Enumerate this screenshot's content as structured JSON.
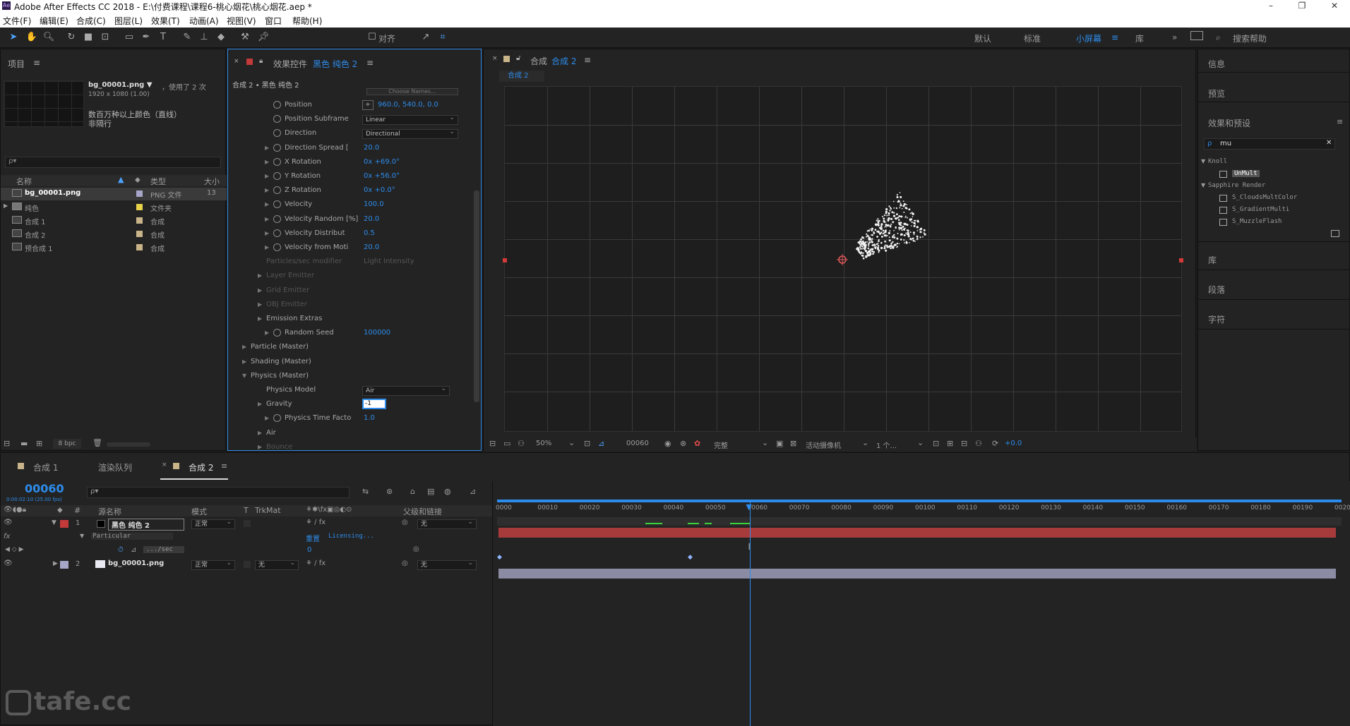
{
  "window": {
    "title": "Adobe After Effects CC 2018 - E:\\付费课程\\课程6-桃心烟花\\桃心烟花.aep *"
  },
  "menu": [
    "文件(F)",
    "编辑(E)",
    "合成(C)",
    "图层(L)",
    "效果(T)",
    "动画(A)",
    "视图(V)",
    "窗口",
    "帮助(H)"
  ],
  "toolbar": {
    "align_label": "对齐",
    "workspaces": [
      "默认",
      "标准",
      "小屏幕",
      "库"
    ],
    "active_workspace": "小屏幕",
    "search_help": "搜索帮助"
  },
  "project": {
    "title": "项目",
    "asset_name": "bg_00001.png ▼",
    "used": "，使用了 2 次",
    "dims": "1920 x 1080 (1.00)",
    "desc1": "数百万种以上颜色（直线）",
    "desc2": "非隔行",
    "search_placeholder": "ρ▾",
    "col_name": "名称",
    "col_type": "类型",
    "col_size": "大小",
    "bpc": "8 bpc",
    "items": [
      {
        "name": "bg_00001.png",
        "type": "PNG 文件",
        "size": "13",
        "color": "#a6a6c8",
        "bold": true
      },
      {
        "name": "纯色",
        "type": "文件夹",
        "size": "",
        "color": "#e8d24a",
        "bold": false
      },
      {
        "name": "合成 1",
        "type": "合成",
        "size": "",
        "color": "#c9b48a",
        "bold": false
      },
      {
        "name": "合成 2",
        "type": "合成",
        "size": "",
        "color": "#c9b48a",
        "bold": false
      },
      {
        "name": "预合成 1",
        "type": "合成",
        "size": "",
        "color": "#c9b48a",
        "bold": false
      }
    ]
  },
  "effects": {
    "tab_prefix": "效果控件",
    "tab_layer": "黑色 纯色 2",
    "breadcrumb": "合成 2 • 黑色 纯色 2",
    "top_button": "Choose Names...",
    "props": [
      {
        "name": "Position",
        "value": "960.0, 540.0, 0.0",
        "indent": 2,
        "sw": true,
        "tri": false,
        "kind": "pos"
      },
      {
        "name": "Position Subframe",
        "value": "Linear",
        "indent": 2,
        "sw": true,
        "tri": false,
        "kind": "dd"
      },
      {
        "name": "Direction",
        "value": "Directional",
        "indent": 2,
        "sw": true,
        "tri": false,
        "kind": "dd"
      },
      {
        "name": "Direction Spread [",
        "value": "20.0",
        "indent": 2,
        "sw": true,
        "tri": true
      },
      {
        "name": "X Rotation",
        "value": "0x +69.0°",
        "indent": 2,
        "sw": true,
        "tri": true
      },
      {
        "name": "Y Rotation",
        "value": "0x +56.0°",
        "indent": 2,
        "sw": true,
        "tri": true
      },
      {
        "name": "Z Rotation",
        "value": "0x +0.0°",
        "indent": 2,
        "sw": true,
        "tri": true
      },
      {
        "name": "Velocity",
        "value": "100.0",
        "indent": 2,
        "sw": true,
        "tri": true
      },
      {
        "name": "Velocity Random [%]",
        "value": "20.0",
        "indent": 2,
        "sw": true,
        "tri": true
      },
      {
        "name": "Velocity Distribut",
        "value": "0.5",
        "indent": 2,
        "sw": true,
        "tri": true
      },
      {
        "name": "Velocity from Moti",
        "value": "20.0",
        "indent": 2,
        "sw": true,
        "tri": true
      },
      {
        "name": "Particles/sec modifier",
        "value": "Light Intensity",
        "indent": 1,
        "sw": false,
        "tri": false,
        "dim": true
      },
      {
        "name": "Layer Emitter",
        "value": "",
        "indent": 1,
        "sw": false,
        "tri": true,
        "dim": true
      },
      {
        "name": "Grid Emitter",
        "value": "",
        "indent": 1,
        "sw": false,
        "tri": true,
        "dim": true
      },
      {
        "name": "OBJ Emitter",
        "value": "",
        "indent": 1,
        "sw": false,
        "tri": true,
        "dim": true
      },
      {
        "name": "Emission Extras",
        "value": "",
        "indent": 1,
        "sw": false,
        "tri": true
      },
      {
        "name": "Random Seed",
        "value": "100000",
        "indent": 2,
        "sw": true,
        "tri": true
      },
      {
        "name": "Particle (Master)",
        "value": "",
        "indent": 0,
        "sw": false,
        "tri": true
      },
      {
        "name": "Shading (Master)",
        "value": "",
        "indent": 0,
        "sw": false,
        "tri": true
      },
      {
        "name": "Physics (Master)",
        "value": "",
        "indent": 0,
        "sw": false,
        "tri": true,
        "open": true
      },
      {
        "name": "Physics Model",
        "value": "Air",
        "indent": 1,
        "sw": false,
        "tri": false,
        "kind": "dd"
      },
      {
        "name": "Gravity",
        "value": "-1",
        "indent": 1,
        "sw": false,
        "tri": true,
        "kind": "edit"
      },
      {
        "name": "Physics Time Facto",
        "value": "1.0",
        "indent": 2,
        "sw": true,
        "tri": true
      },
      {
        "name": "Air",
        "value": "",
        "indent": 1,
        "sw": false,
        "tri": true
      },
      {
        "name": "Bounce",
        "value": "",
        "indent": 1,
        "sw": false,
        "tri": true,
        "dim": true
      }
    ]
  },
  "composition": {
    "tab_prefix": "合成",
    "tab_name": "合成 2",
    "subtab": "合成 2",
    "zoom": "50%",
    "timecode": "00060",
    "quality": "完整",
    "camera": "活动摄像机",
    "views": "1 个...",
    "exposure": "+0.0"
  },
  "right_panel": {
    "info": "信息",
    "preview": "预览",
    "effects_presets": "效果和预设",
    "search_value": "mu",
    "tree": [
      {
        "label": "Knoll",
        "level": 0
      },
      {
        "label": "UnMult",
        "level": 1,
        "selected": true
      },
      {
        "label": "Sapphire Render",
        "level": 0
      },
      {
        "label": "S_CloudsMultColor",
        "level": 1
      },
      {
        "label": "S_GradientMulti",
        "level": 1
      },
      {
        "label": "S_MuzzleFlash",
        "level": 1
      }
    ],
    "library": "库",
    "paragraph": "段落",
    "character": "字符"
  },
  "timeline": {
    "tabs": [
      "合成 1",
      "渲染队列",
      "合成 2"
    ],
    "active_tab": "合成 2",
    "timecode": "00060",
    "timecode_sub": "0:00:02:10 (25.00 fps)",
    "search_placeholder": "ρ▾",
    "columns": {
      "source": "源名称",
      "mode": "模式",
      "t": "T",
      "trkmat": "TrkMat",
      "parent": "父级和链接"
    },
    "layers": [
      {
        "num": "1",
        "name": "黑色 纯色 2",
        "mode": "正常",
        "trkmat": "",
        "parent": "无",
        "color": "#c23a3a"
      },
      {
        "num": "2",
        "name": "bg_00001.png",
        "mode": "正常",
        "trkmat": "无",
        "parent": "无",
        "color": "#a6a6c8"
      }
    ],
    "effect_row": {
      "label": "Particular",
      "reset": "重置",
      "licensing": "Licensing..."
    },
    "sub_row": {
      "label": ".../sec",
      "value": "0"
    },
    "ruler": [
      "0000",
      "00010",
      "00020",
      "00030",
      "00040",
      "00050",
      "00060",
      "00070",
      "00080",
      "00090",
      "00100",
      "00110",
      "00120",
      "00130",
      "00140",
      "00150",
      "00160",
      "00170",
      "00180",
      "00190",
      "0020"
    ],
    "current_frame": 60,
    "total_frames": 200
  },
  "watermark": "tafe.cc"
}
